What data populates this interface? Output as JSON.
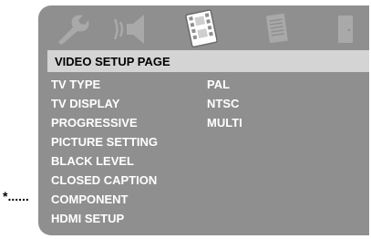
{
  "header": {
    "title": "VIDEO SETUP PAGE"
  },
  "icons": [
    "wrench-icon",
    "speaker-icon",
    "film-icon",
    "document-icon",
    "door-icon"
  ],
  "menu": {
    "items": [
      "TV TYPE",
      "TV DISPLAY",
      "PROGRESSIVE",
      "PICTURE SETTING",
      "BLACK LEVEL",
      "CLOSED CAPTION",
      "COMPONENT",
      "HDMI SETUP"
    ]
  },
  "options": [
    "PAL",
    "NTSC",
    "MULTI"
  ],
  "annotation": {
    "marker": "*......"
  },
  "colors": {
    "panel": "#8f8f8f",
    "header": "#d4d4d4",
    "text": "#ffffff",
    "icon": "#a9a9a9"
  }
}
